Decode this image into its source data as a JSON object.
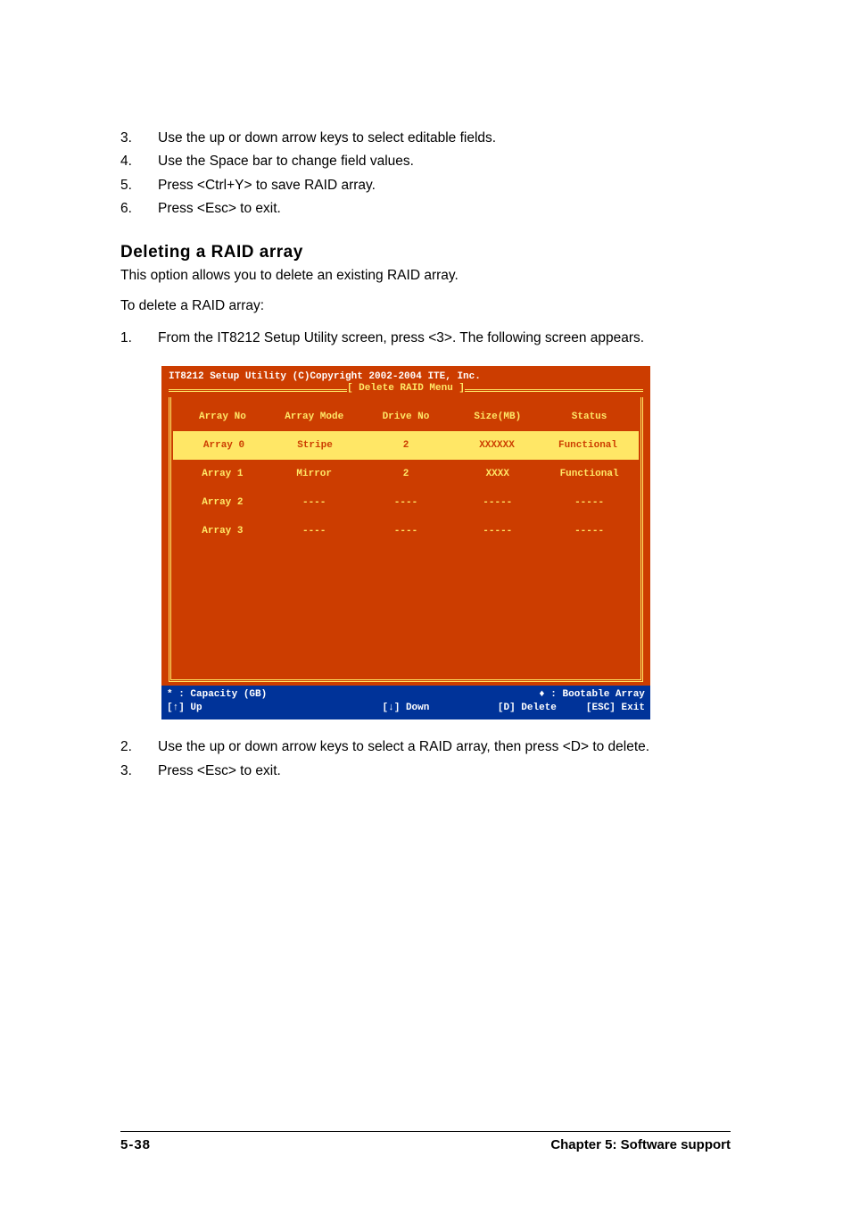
{
  "steps_a": [
    {
      "n": "3.",
      "t": "Use the up or down arrow keys to select editable fields."
    },
    {
      "n": "4.",
      "t": "Use the Space bar to change field values."
    },
    {
      "n": "5.",
      "t": "Press <Ctrl+Y> to save RAID array."
    },
    {
      "n": "6.",
      "t": "Press <Esc> to exit."
    }
  ],
  "heading": "Deleting a RAID array",
  "para1": "This option allows you to delete an existing RAID array.",
  "para2": "To delete a RAID array:",
  "step_b1": {
    "n": "1.",
    "t": "From the IT8212 Setup Utility screen, press <3>. The following screen appears."
  },
  "bios": {
    "header": "IT8212 Setup Utility (C)Copyright 2002-2004 ITE, Inc.",
    "title": "[ Delete RAID Menu ]",
    "cols": [
      "Array No",
      "Array Mode",
      "Drive No",
      "Size(MB)",
      "Status"
    ],
    "rows": [
      [
        "Array 0",
        "Stripe",
        "2",
        "XXXXXX",
        "Functional"
      ],
      [
        "Array 1",
        "Mirror",
        "2",
        "XXXX",
        "Functional"
      ],
      [
        "Array 2",
        "----",
        "----",
        "-----",
        "-----"
      ],
      [
        "Array 3",
        "----",
        "----",
        "-----",
        "-----"
      ]
    ],
    "footer": {
      "cap": "* : Capacity (GB)",
      "boot": "♦ : Bootable Array",
      "up": "[↑] Up",
      "down": "[↓] Down",
      "del": "[D] Delete",
      "exit": "[ESC] Exit"
    }
  },
  "steps_c": [
    {
      "n": "2.",
      "t": "Use the up or down arrow keys to select a RAID array, then press <D> to delete."
    },
    {
      "n": "3.",
      "t": "Press <Esc> to exit."
    }
  ],
  "footer": {
    "page": "5-38",
    "chapter": "Chapter 5: Software support"
  }
}
